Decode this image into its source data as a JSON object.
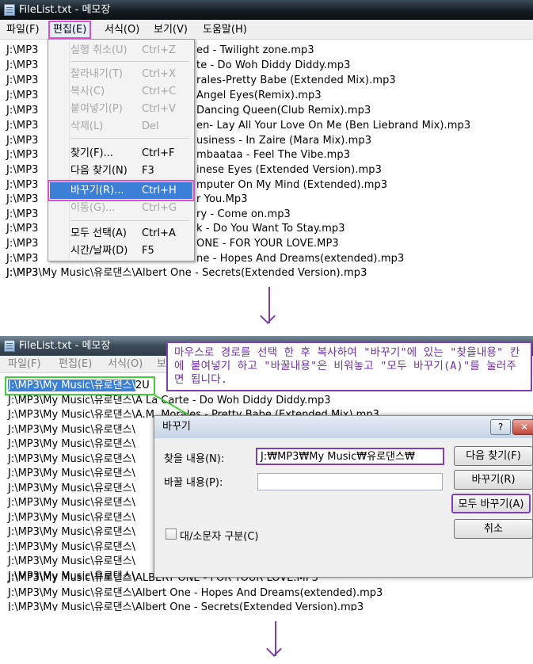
{
  "panel1": {
    "title": "FileList.txt - 메모장",
    "menu": [
      "파일(F)",
      "편집(E)",
      "서식(O)",
      "보기(V)",
      "도움말(H)"
    ],
    "lines": [
      "J:\\MP3",
      "J:\\MP3",
      "J:\\MP3",
      "J:\\MP3",
      "J:\\MP3",
      "J:\\MP3",
      "J:\\MP3",
      "J:\\MP3",
      "J:\\MP3",
      "J:\\MP3",
      "J:\\MP3",
      "J:\\MP3",
      "J:\\MP3",
      "J:\\MP3",
      "J:\\MP3",
      "J:\\MP3",
      "J:\\MP3\\My Music\\유로댄스\\Albert One - Secrets(Extended Version).mp3"
    ],
    "line_tails": [
      "ed - Twilight zone.mp3",
      "te - Do Woh Diddy Diddy.mp3",
      "rales-Pretty Babe (Extended Mix).mp3",
      "Angel Eyes(Remix).mp3",
      "Dancing Queen(Club Remix).mp3",
      "en- Lay All Your Love On Me (Ben Liebrand Mix).mp3",
      "usiness - In Zaire (Mara Mix).mp3",
      "mbaataa - Feel The Vibe.mp3",
      "inese Eyes (Extended Version).mp3",
      "mputer On My Mind (Extended).mp3",
      "r You.Mp3",
      "ry - Come on.mp3",
      "k - Do You Want To Stay.mp3",
      "ONE - FOR YOUR LOVE.MP3",
      "ne - Hopes And Dreams(extended).mp3",
      "",
      ""
    ],
    "dropdown": {
      "items": [
        {
          "label": "실행 취소(U)",
          "shortcut": "Ctrl+Z"
        },
        {
          "label": "잘라내기(T)",
          "shortcut": "Ctrl+X"
        },
        {
          "label": "복사(C)",
          "shortcut": "Ctrl+C"
        },
        {
          "label": "붙여넣기(P)",
          "shortcut": "Ctrl+V"
        },
        {
          "label": "삭제(L)",
          "shortcut": "Del"
        },
        {
          "label": "찾기(F)...",
          "shortcut": "Ctrl+F"
        },
        {
          "label": "다음 찾기(N)",
          "shortcut": "F3"
        },
        {
          "label": "바꾸기(R)...",
          "shortcut": "Ctrl+H"
        },
        {
          "label": "이동(G)...",
          "shortcut": "Ctrl+G"
        },
        {
          "label": "모두 선택(A)",
          "shortcut": "Ctrl+A"
        },
        {
          "label": "시간/날짜(D)",
          "shortcut": "F5"
        }
      ]
    }
  },
  "panel2": {
    "title": "FileList.txt - 메모장",
    "menu": [
      "파일(F)",
      "편집(E)",
      "서식(O)",
      "보"
    ],
    "selected_prefix": "J:\\MP3\\My Music\\유로댄스\\",
    "first_line_tail": "2U",
    "line_prefix": "J:\\MP3\\My Music\\유로댄스\\",
    "lines": [
      "A La Carte - Do Woh Diddy Diddy.mp3",
      "A.M. Morales - Pretty Babe (Extended Mix).mp3",
      "",
      "",
      "",
      "",
      "",
      "",
      "",
      "",
      "",
      "",
      "",
      "ALBERT ONE - FOR YOUR LOVE.MP3",
      "Albert One - Hopes And Dreams(extended).mp3",
      "Albert One - Secrets(Extended Version).mp3"
    ],
    "annotation": "마우스로 경로를 선택 한 후 복사하여 \"바꾸기\"에 있는 \"찾을내용\" 칸에 붙여넣기 하고 \"바꿀내용\"은 비워놓고 \"모두 바꾸기(A)\"를 눌러주면 됩니다.",
    "dialog": {
      "title": "바꾸기",
      "help": "?",
      "find_label": "찾을 내용(N):",
      "find_value": "J:₩MP3₩My Music₩유로댄스₩",
      "replace_label": "바꿀 내용(P):",
      "replace_value": "",
      "case_label": "대/소문자 구분(C)",
      "buttons": [
        "다음 찾기(F)",
        "바꾸기(R)",
        "모두 바꾸기(A)",
        "취소"
      ]
    }
  },
  "colors": {
    "highlight_magenta": "#d94fd0",
    "annotation_purple": "#8040b0",
    "selection_green": "#3ed035",
    "selection_blue": "#3c7fd6"
  }
}
